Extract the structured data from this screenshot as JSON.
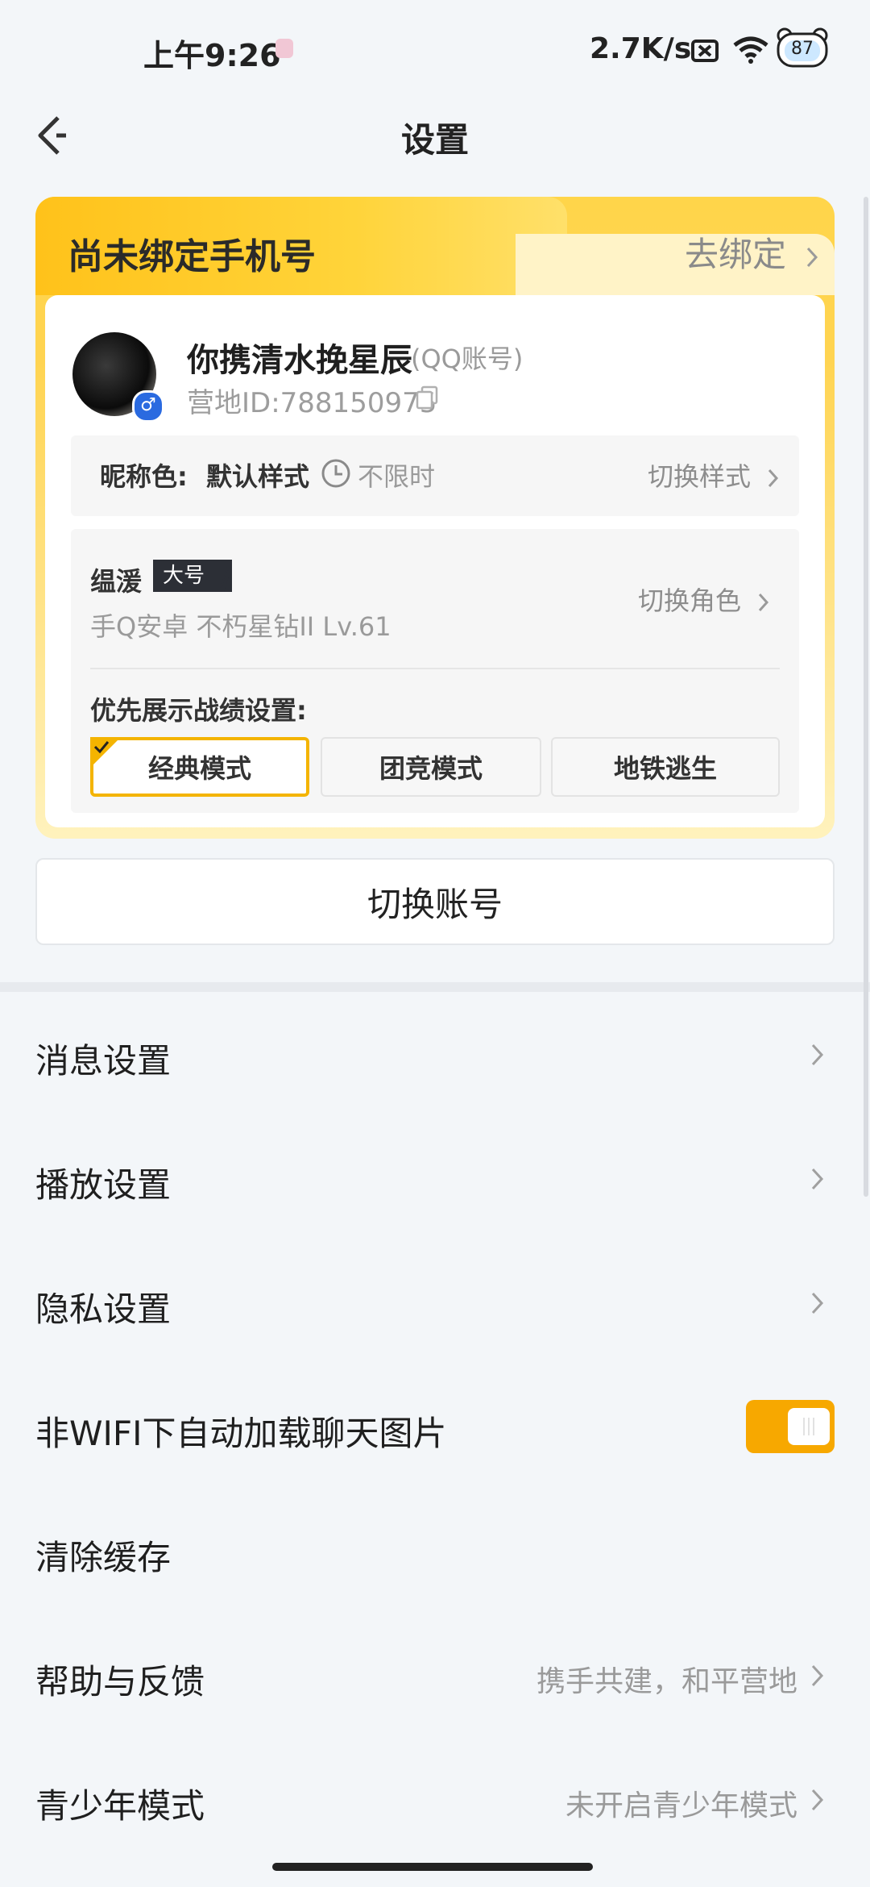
{
  "status_bar": {
    "time": "上午9:26",
    "network_speed": "2.7K/s",
    "battery": "87"
  },
  "header": {
    "title": "设置"
  },
  "account_card": {
    "bind_title": "尚未绑定手机号",
    "bind_action": "去绑定",
    "nickname": "你携清水挽星辰",
    "account_type": "(QQ账号)",
    "camp_id": "营地ID:788150975",
    "nickname_color_label": "昵称色:",
    "nickname_color_value": "默认样式",
    "nickname_color_duration": "不限时",
    "switch_style": "切换样式",
    "role_name": "缊湲",
    "role_tag": "大号",
    "role_info": "手Q安卓  不朽星钻II  Lv.61",
    "switch_role": "切换角色",
    "record_setting_label": "优先展示战绩设置:",
    "modes": [
      "经典模式",
      "团竞模式",
      "地铁逃生"
    ],
    "selected_mode": "经典模式"
  },
  "switch_account": "切换账号",
  "menu": {
    "message_settings": "消息设置",
    "playback_settings": "播放设置",
    "privacy_settings": "隐私设置",
    "auto_load_images": "非WIFI下自动加载聊天图片",
    "auto_load_images_on": true,
    "clear_cache": "清除缓存",
    "help_feedback": "帮助与反馈",
    "help_feedback_hint": "携手共建，和平营地",
    "teen_mode": "青少年模式",
    "teen_mode_hint": "未开启青少年模式"
  },
  "colors": {
    "accent": "#f7a800",
    "card_yellow": "#ffd43a",
    "background": "#f3f6f9"
  }
}
